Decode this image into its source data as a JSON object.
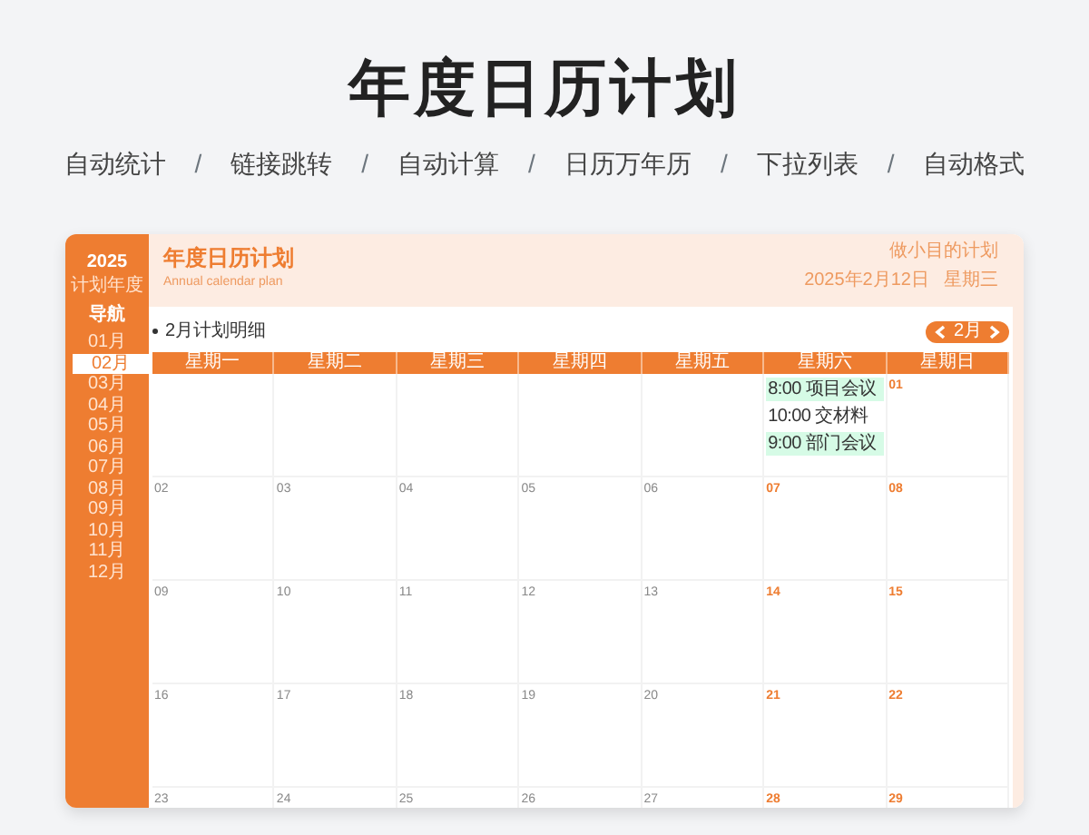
{
  "page_title": "年度日历计划",
  "subtitle_items": [
    {
      "kind": "feature",
      "text": "自动统计"
    },
    {
      "kind": "separator",
      "text": "/"
    },
    {
      "kind": "feature",
      "text": "链接跳转"
    },
    {
      "kind": "separator",
      "text": "/"
    },
    {
      "kind": "feature",
      "text": "自动计算"
    },
    {
      "kind": "separator",
      "text": "/"
    },
    {
      "kind": "feature",
      "text": "日历万年历"
    },
    {
      "kind": "separator",
      "text": "/"
    },
    {
      "kind": "feature",
      "text": "下拉列表"
    },
    {
      "kind": "separator",
      "text": "/"
    },
    {
      "kind": "feature",
      "text": "自动格式"
    }
  ],
  "sidebar": {
    "year": "2025",
    "year_label": "计划年度",
    "nav_label": "导航",
    "months": [
      {
        "label": "01月",
        "selected": false
      },
      {
        "label": "02月",
        "selected": true
      },
      {
        "label": "03月",
        "selected": false
      },
      {
        "label": "04月",
        "selected": false
      },
      {
        "label": "05月",
        "selected": false
      },
      {
        "label": "06月",
        "selected": false
      },
      {
        "label": "07月",
        "selected": false
      },
      {
        "label": "08月",
        "selected": false
      },
      {
        "label": "09月",
        "selected": false
      },
      {
        "label": "10月",
        "selected": false
      },
      {
        "label": "11月",
        "selected": false
      },
      {
        "label": "12月",
        "selected": false
      }
    ]
  },
  "header": {
    "title": "年度日历计划",
    "subtitle": "Annual calendar plan",
    "tagline": "做小目的计划",
    "date": "2025年2月12日",
    "weekday": "星期三"
  },
  "section_title": "2月计划明细",
  "month_picker": {
    "label": "2月"
  },
  "weekdays": [
    "星期一",
    "星期二",
    "星期三",
    "星期四",
    "星期五",
    "星期六",
    "星期日"
  ],
  "weeks": [
    [
      {
        "events": [
          {
            "text": "8:00 项目会议",
            "highlighted": true
          },
          {
            "text": "10:00 交材料",
            "highlighted": false
          },
          {
            "text": "9:00 部门会议",
            "highlighted": true
          }
        ]
      },
      {
        "day": "01",
        "weekend": true
      }
    ],
    [
      {
        "day": "02",
        "weekend": false
      },
      {
        "day": "03",
        "weekend": false
      },
      {
        "day": "04",
        "weekend": false
      },
      {
        "day": "05",
        "weekend": false
      },
      {
        "day": "06",
        "weekend": false
      },
      {
        "day": "07",
        "weekend": true
      },
      {
        "day": "08",
        "weekend": true
      }
    ],
    [
      {
        "day": "09",
        "weekend": false
      },
      {
        "day": "10",
        "weekend": false
      },
      {
        "day": "11",
        "weekend": false
      },
      {
        "day": "12",
        "weekend": false
      },
      {
        "day": "13",
        "weekend": false
      },
      {
        "day": "14",
        "weekend": true
      },
      {
        "day": "15",
        "weekend": true
      }
    ],
    [
      {
        "day": "16",
        "weekend": false
      },
      {
        "day": "17",
        "weekend": false
      },
      {
        "day": "18",
        "weekend": false
      },
      {
        "day": "19",
        "weekend": false
      },
      {
        "day": "20",
        "weekend": false
      },
      {
        "day": "21",
        "weekend": true
      },
      {
        "day": "22",
        "weekend": true
      }
    ],
    [
      {
        "day": "23",
        "weekend": false
      },
      {
        "day": "24",
        "weekend": false
      },
      {
        "day": "25",
        "weekend": false
      },
      {
        "day": "26",
        "weekend": false
      },
      {
        "day": "27",
        "weekend": false
      },
      {
        "day": "28",
        "weekend": true
      },
      {
        "day": "29",
        "weekend": true
      }
    ]
  ]
}
